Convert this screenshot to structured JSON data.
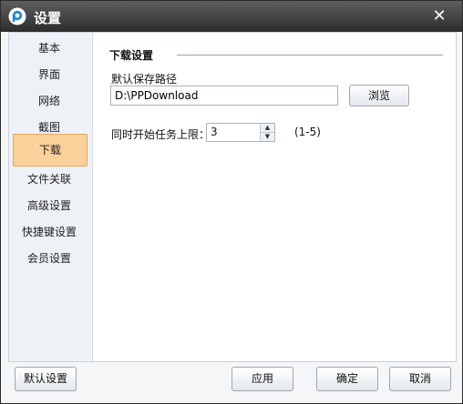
{
  "window": {
    "title": "设置"
  },
  "sidebar": {
    "items": [
      {
        "label": "基本"
      },
      {
        "label": "界面"
      },
      {
        "label": "网络"
      },
      {
        "label": "截图"
      },
      {
        "label": "下载",
        "active": true
      },
      {
        "label": "文件关联"
      },
      {
        "label": "高级设置"
      },
      {
        "label": "快捷键设置"
      },
      {
        "label": "会员设置"
      }
    ]
  },
  "download": {
    "section_title": "下载设置",
    "path_label": "默认保存路径",
    "path_value": "D:\\PPDownload",
    "browse_label": "浏览",
    "task_limit_label": "同时开始任务上限：",
    "task_limit_value": "3",
    "task_limit_range": "(1-5)"
  },
  "footer": {
    "defaults_label": "默认设置",
    "apply_label": "应用",
    "ok_label": "确定",
    "cancel_label": "取消"
  },
  "colors": {
    "titlebar": "#3a3a3a",
    "sidebar_bg": "#eef2f6",
    "active_item": "#fbd19b",
    "logo_blue": "#1e88d8"
  }
}
